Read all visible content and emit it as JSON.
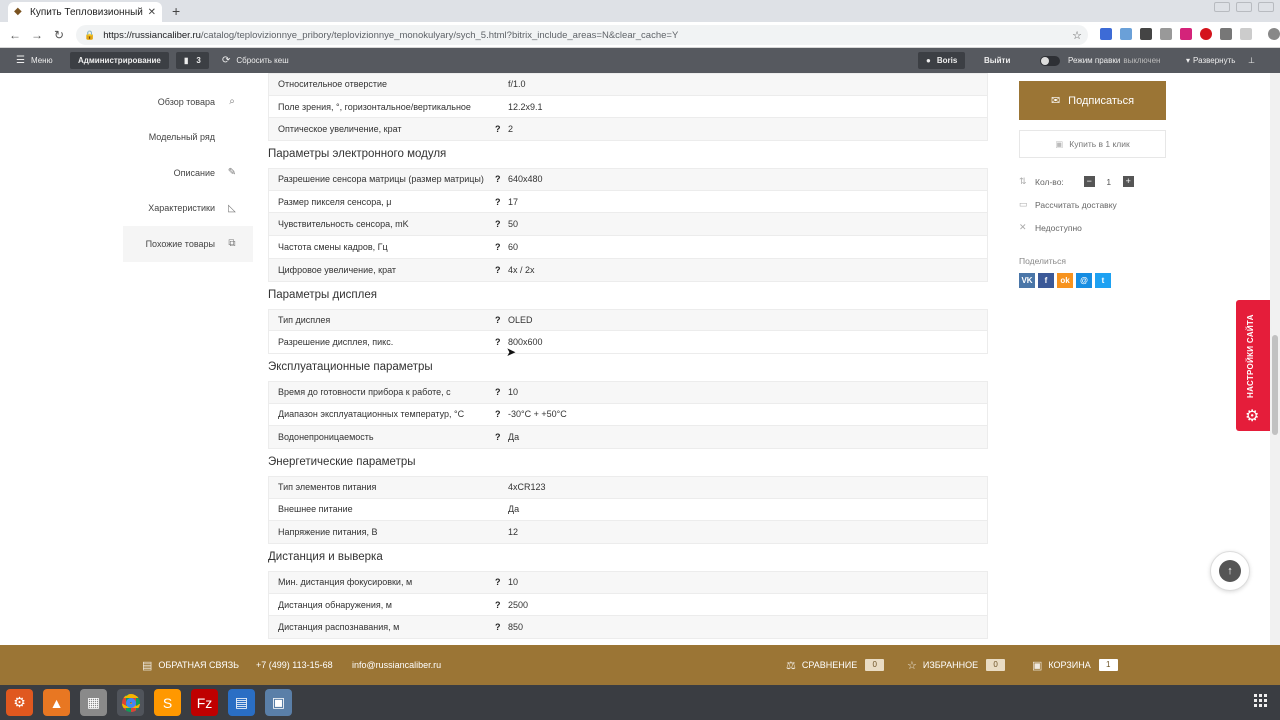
{
  "browser": {
    "tab_title": "Купить Тепловизионный",
    "tab_favicon": "shop-icon",
    "url_host": "https://russiancaliber.ru",
    "url_path": "/catalog/teplovizionnye_pribory/teplovizionnye_monokulyary/sych_5.html?bitrix_include_areas=N&clear_cache=Y"
  },
  "admin": {
    "menu": "Меню",
    "administration": "Администрирование",
    "comments_count": "3",
    "reset_cache": "Сбросить кеш",
    "user": "Boris",
    "logout": "Выйти",
    "edit_mode": "Режим правки",
    "edit_mode_state": "выключен",
    "expand": "Развернуть"
  },
  "leftnav": [
    {
      "label": "Обзор товара",
      "icon": "search-icon"
    },
    {
      "label": "Модельный ряд",
      "icon": ""
    },
    {
      "label": "Описание",
      "icon": "edit-icon"
    },
    {
      "label": "Характеристики",
      "icon": "ruler-icon"
    },
    {
      "label": "Похожие товары",
      "icon": "copy-icon"
    }
  ],
  "specs": {
    "top_rows": [
      {
        "name": "Относительное отверстие",
        "q": "",
        "value": "f/1.0"
      },
      {
        "name": "Поле зрения, °, горизонтальное/вертикальное",
        "q": "",
        "value": "12.2x9.1"
      },
      {
        "name": "Оптическое увеличение, крат",
        "q": "?",
        "value": "2"
      }
    ],
    "sections": [
      {
        "title": "Параметры электронного модуля",
        "rows": [
          {
            "name": "Разрешение сенсора матрицы (размер матрицы)",
            "q": "?",
            "value": "640x480"
          },
          {
            "name": "Размер пикселя сенсора, μ",
            "q": "?",
            "value": "17"
          },
          {
            "name": "Чувствительность сенсора, mK",
            "q": "?",
            "value": "50"
          },
          {
            "name": "Частота смены кадров, Гц",
            "q": "?",
            "value": "60"
          },
          {
            "name": "Цифровое увеличение, крат",
            "q": "?",
            "value": "4x / 2x"
          }
        ]
      },
      {
        "title": "Параметры дисплея",
        "rows": [
          {
            "name": "Тип дисплея",
            "q": "?",
            "value": "OLED"
          },
          {
            "name": "Разрешение дисплея, пикс.",
            "q": "?",
            "value": "800x600"
          }
        ]
      },
      {
        "title": "Эксплуатационные параметры",
        "rows": [
          {
            "name": "Время до готовности прибора к работе, с",
            "q": "?",
            "value": "10"
          },
          {
            "name": "Диапазон эксплуатационных температур, °C",
            "q": "?",
            "value": "-30°C + +50°C"
          },
          {
            "name": "Водонепроницаемость",
            "q": "?",
            "value": "Да"
          }
        ]
      },
      {
        "title": "Энергетические параметры",
        "rows": [
          {
            "name": "Тип элементов питания",
            "q": "",
            "value": "4xCR123"
          },
          {
            "name": "Внешнее питание",
            "q": "",
            "value": "Да"
          },
          {
            "name": "Напряжение питания, В",
            "q": "",
            "value": "12"
          }
        ]
      },
      {
        "title": "Дистанция и выверка",
        "rows": [
          {
            "name": "Мин. дистанция фокусировки, м",
            "q": "?",
            "value": "10"
          },
          {
            "name": "Дистанция обнаружения, м",
            "q": "?",
            "value": "2500"
          },
          {
            "name": "Дистанция распознавания, м",
            "q": "?",
            "value": "850"
          }
        ]
      }
    ]
  },
  "sidebar": {
    "subscribe": "Подписаться",
    "buy_one_click": "Купить в 1 клик",
    "qty_label": "Кол-во:",
    "qty_value": "1",
    "calc_delivery": "Рассчитать доставку",
    "unavailable": "Недоступно",
    "share": "Поделиться",
    "social": [
      {
        "name": "vk-icon",
        "glyph": "VK",
        "color": "#4a76a8"
      },
      {
        "name": "facebook-icon",
        "glyph": "f",
        "color": "#3b5998"
      },
      {
        "name": "odnoklassniki-icon",
        "glyph": "ok",
        "color": "#f7931e"
      },
      {
        "name": "mailru-icon",
        "glyph": "@",
        "color": "#168de2"
      },
      {
        "name": "twitter-icon",
        "glyph": "t",
        "color": "#1da1f2"
      }
    ]
  },
  "settings_tab": "НАСТРОЙКИ САЙТА",
  "bottom": {
    "feedback": "ОБРАТНАЯ СВЯЗЬ",
    "phone": "+7 (499) 113-15-68",
    "email": "info@russiancaliber.ru",
    "compare": "СРАВНЕНИЕ",
    "compare_count": "0",
    "favorites": "ИЗБРАННОЕ",
    "favorites_count": "0",
    "cart": "КОРЗИНА",
    "cart_count": "1"
  },
  "colors": {
    "accent": "#9b7535",
    "settings_red": "#e51d3a",
    "admin_bar": "#56595f"
  }
}
